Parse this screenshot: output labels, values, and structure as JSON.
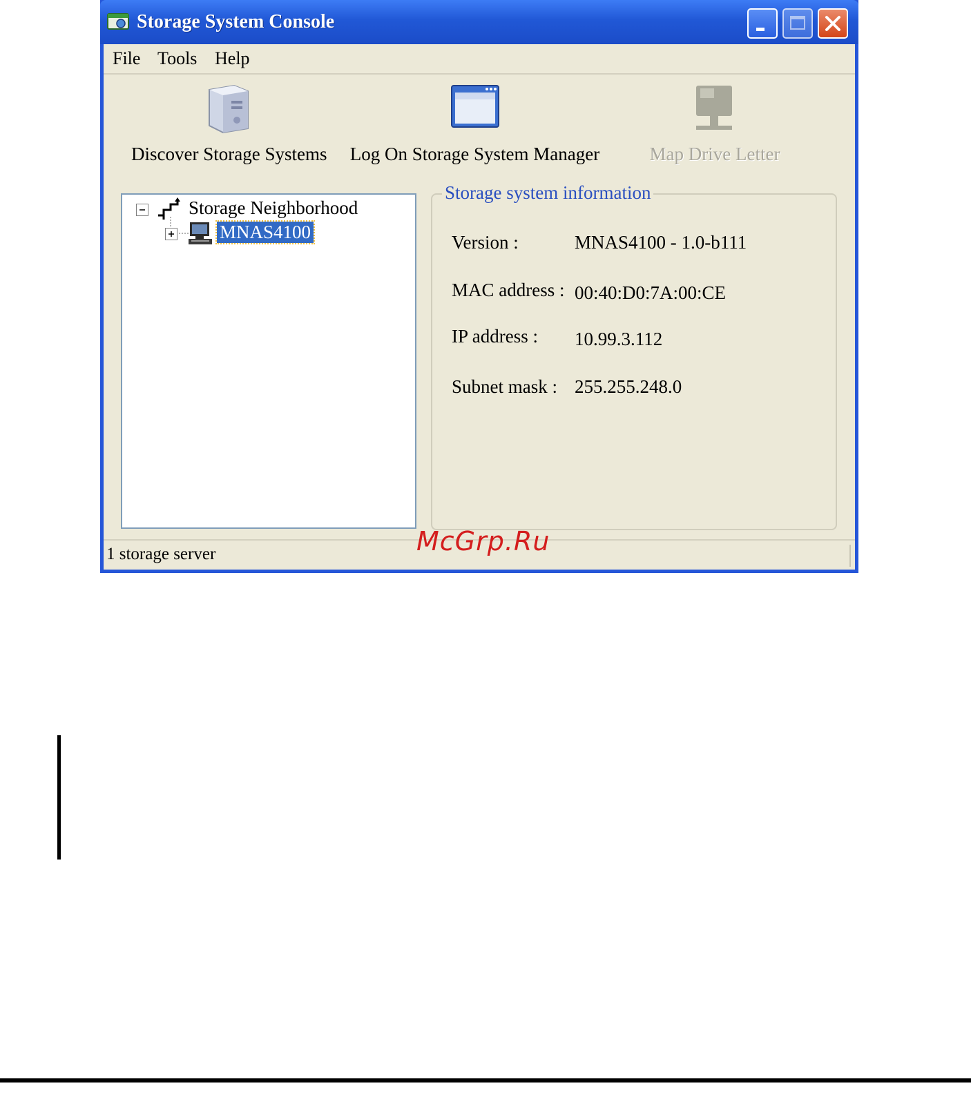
{
  "window": {
    "title": "Storage System Console",
    "icon": "console-app-icon",
    "buttons": [
      "minimize-icon",
      "maximize-icon",
      "close-icon"
    ]
  },
  "menu": {
    "file": "File",
    "tools": "Tools",
    "help": "Help"
  },
  "toolbar": {
    "discover": {
      "label": "Discover Storage Systems",
      "icon": "storage-server-icon"
    },
    "logon": {
      "label": "Log On Storage System Manager",
      "icon": "browser-window-icon"
    },
    "map_drive": {
      "label": "Map Drive Letter",
      "icon": "network-drive-icon",
      "disabled": true
    }
  },
  "tree": {
    "root": {
      "label": "Storage Neighborhood",
      "expanded": true,
      "icon": "network-icon"
    },
    "children": [
      {
        "label": "MNAS4100",
        "selected": true,
        "expanded": false,
        "icon": "computer-icon"
      }
    ]
  },
  "info": {
    "title": "Storage system information",
    "version_label": "Version :",
    "version_value": "MNAS4100 - 1.0-b111",
    "mac_label": "MAC address :",
    "mac_value": "00:40:D0:7A:00:CE",
    "ip_label": "IP address :",
    "ip_value": "10.99.3.112",
    "subnet_label": "Subnet mask :",
    "subnet_value": "255.255.248.0"
  },
  "status": {
    "text": "1 storage server"
  },
  "watermark": "McGrp.Ru",
  "colors": {
    "title_bar": "#2158d6",
    "client_bg": "#ece9d8",
    "selection": "#316ac5",
    "group_title": "#2a4fc0",
    "watermark": "#d41e1e"
  }
}
